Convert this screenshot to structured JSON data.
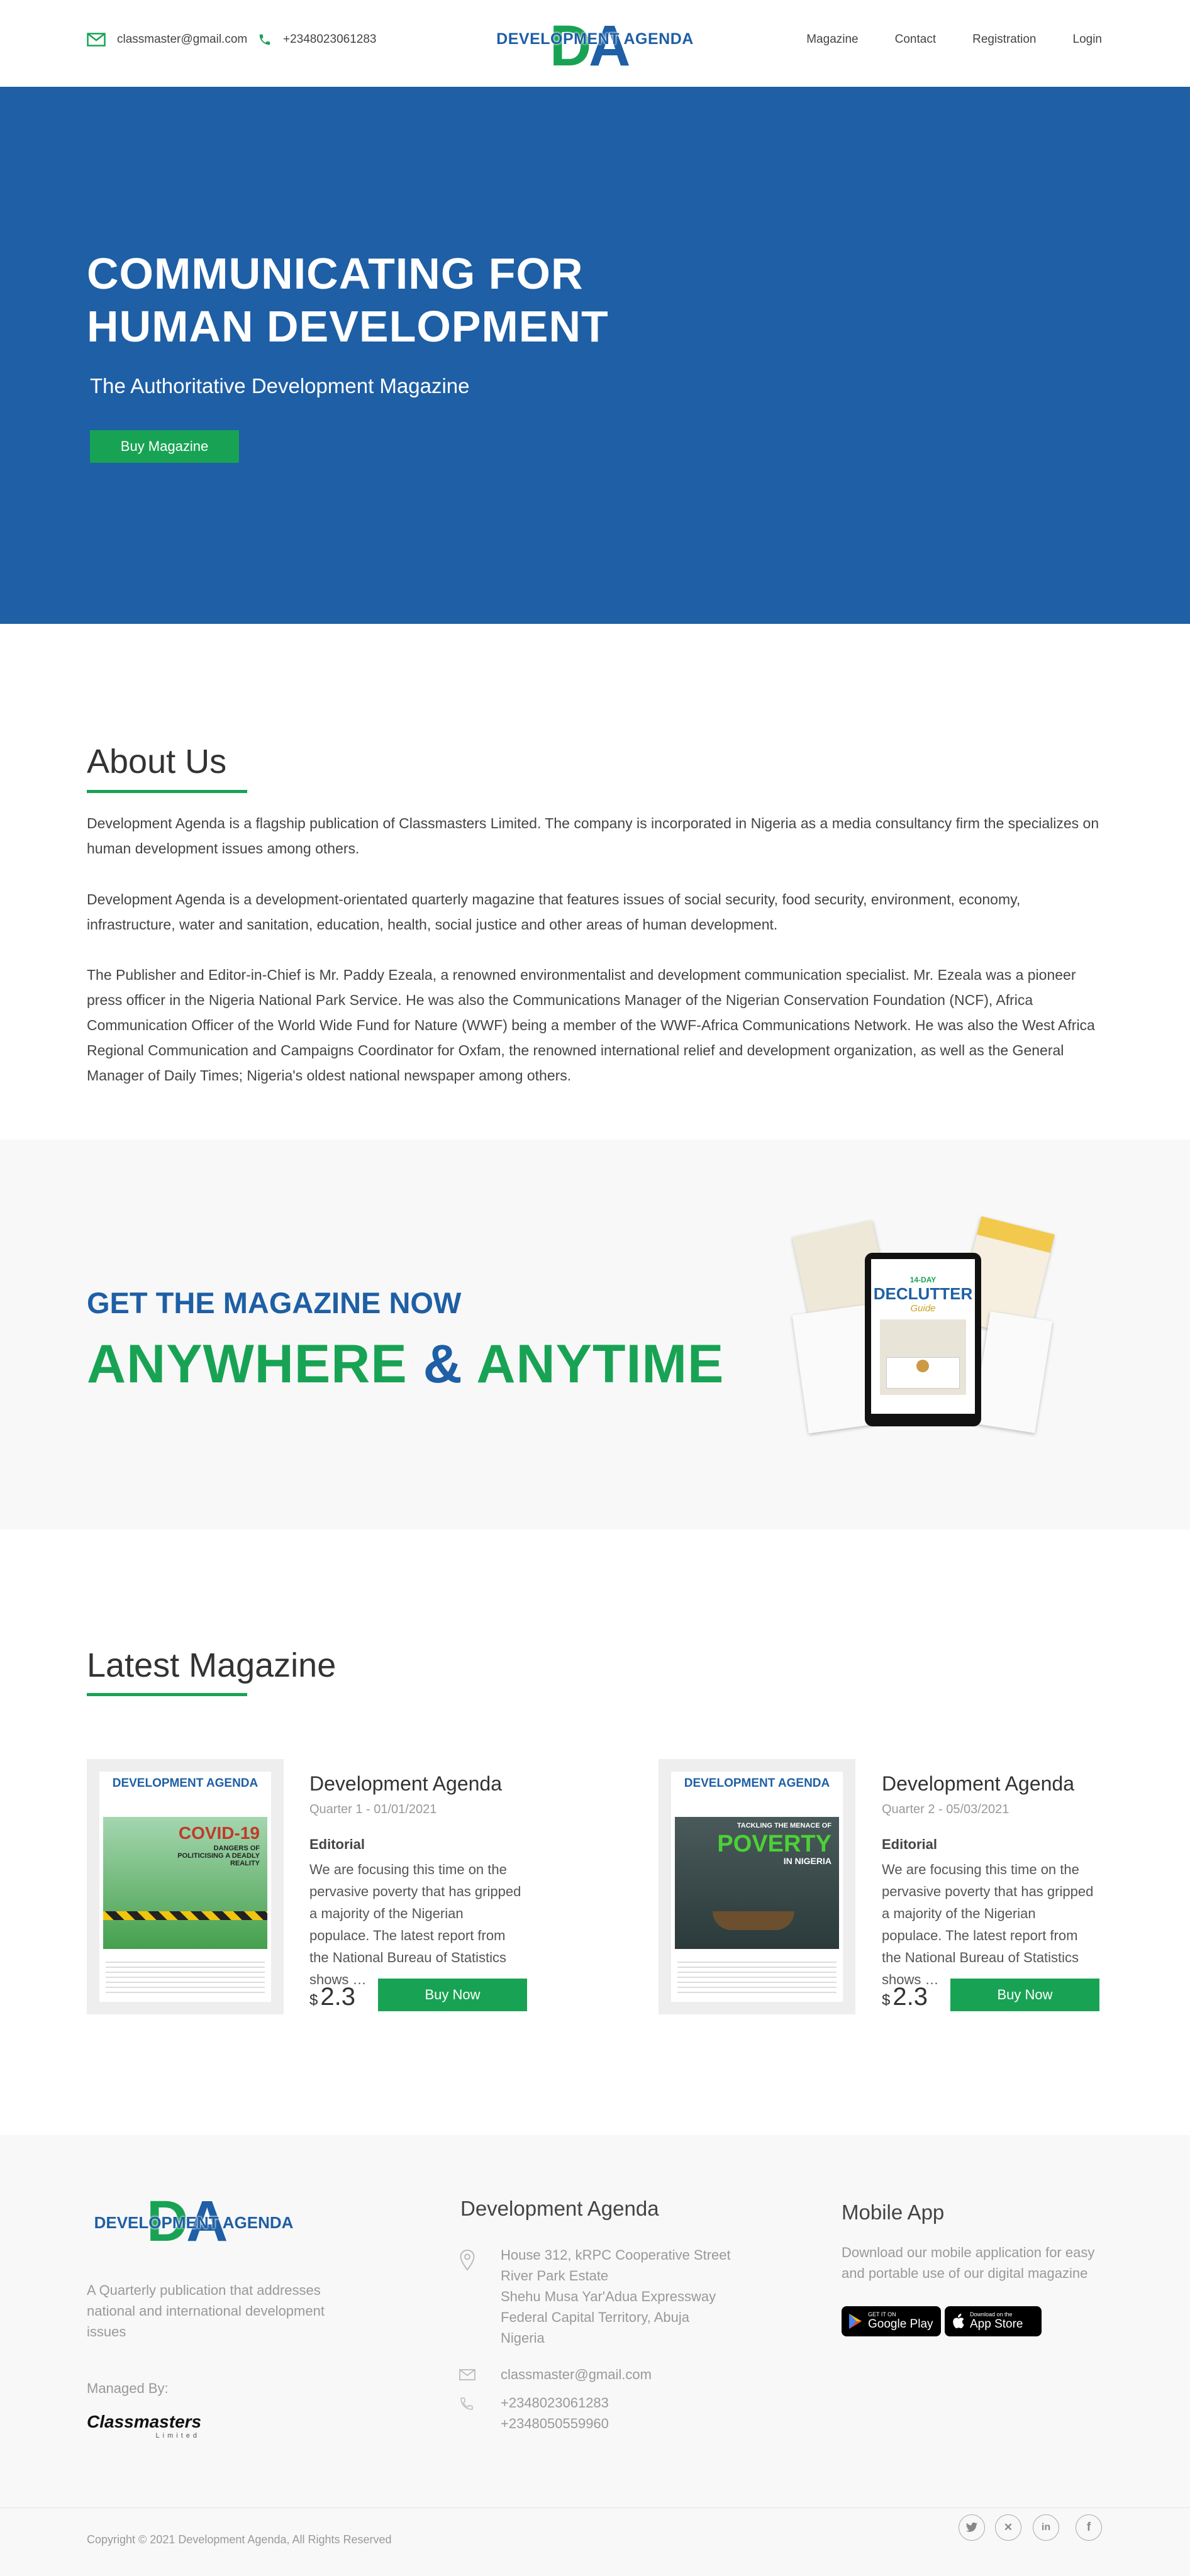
{
  "header": {
    "email": "classmaster@gmail.com",
    "phone": "+2348023061283",
    "logo_text": "DEVELOPMENT AGENDA",
    "logo_mark": "DA",
    "nav": [
      "Magazine",
      "Contact",
      "Registration",
      "Login"
    ]
  },
  "hero": {
    "title": "COMMUNICATING FOR HUMAN DEVELOPMENT",
    "subtitle": "The Authoritative Development Magazine",
    "button": "Buy Magazine"
  },
  "about": {
    "title": "About Us",
    "paragraphs": [
      "Development Agenda is a flagship publication of Classmasters Limited. The company is incorporated in Nigeria as a media consultancy firm the specializes on human development issues among others.",
      "Development Agenda is a development-orientated quarterly magazine that features issues of social security, food security, environment, economy, infrastructure, water and sanitation, education, health, social justice and other areas of human development.",
      "The Publisher and Editor-in-Chief is Mr. Paddy Ezeala, a renowned environmentalist and development communication specialist. Mr. Ezeala was a pioneer press officer in the Nigeria National Park Service. He was also the Communications Manager of the Nigerian Conservation Foundation (NCF), Africa Communication Officer of the World Wide Fund for Nature (WWF) being a member of the WWF-Africa Communications Network. He was also the West Africa Regional Communication and Campaigns Coordinator for Oxfam, the renowned international relief and development organization, as well as the General Manager of Daily Times; Nigeria's oldest national newspaper among others."
    ]
  },
  "promo": {
    "small": "GET THE MAGAZINE NOW",
    "big_1": "ANYWHERE",
    "big_amp": "&",
    "big_2": "ANYTIME",
    "tablet_title_top": "14-DAY",
    "tablet_title": "DECLUTTER",
    "tablet_title_sub": "Guide"
  },
  "latest": {
    "title": "Latest Magazine",
    "items": [
      {
        "name": "Development Agenda",
        "date": "Quarter 1 - 01/01/2021",
        "section": "Editorial",
        "desc": "We are focusing this time on the pervasive poverty that has gripped a majority of the Nigerian populace. The latest report from the National Bureau of Statistics shows …",
        "currency": "$",
        "price": "2.3",
        "button": "Buy Now",
        "cover_headline": "COVID-19",
        "cover_sub": "DANGERS OF POLITICISING A DEADLY REALITY"
      },
      {
        "name": "Development Agenda",
        "date": "Quarter 2 - 05/03/2021",
        "section": "Editorial",
        "desc": "We are focusing this time on the pervasive poverty that has gripped a majority of the Nigerian populace. The latest report from the National Bureau of Statistics shows …",
        "currency": "$",
        "price": "2.3",
        "button": "Buy Now",
        "cover_headline": "POVERTY",
        "cover_sub": "TACKLING THE MENACE OF",
        "cover_sub2": "IN NIGERIA"
      }
    ]
  },
  "footer": {
    "tagline": "A Quarterly publication that addresses national and international development issues",
    "managed_by": "Managed By:",
    "managed_logo": "Classmasters",
    "managed_logo_sub": "Limited",
    "col2_title": "Development Agenda",
    "address": [
      "House 312, kRPC Cooperative Street",
      "River Park Estate",
      "Shehu Musa Yar'Adua Expressway",
      "Federal Capital Territory, Abuja",
      "Nigeria"
    ],
    "email": "classmaster@gmail.com",
    "phones": [
      "+2348023061283",
      "+2348050559960"
    ],
    "col3_title": "Mobile App",
    "app_text": "Download our mobile application for easy and portable use of our digital magazine",
    "google_small": "GET IT ON",
    "google_big": "Google Play",
    "apple_small": "Download on the",
    "apple_big": "App Store",
    "copyright": "Copyright © 2021 Development Agenda, All Rights Reserved"
  },
  "colors": {
    "blue": "#1e5fa5",
    "green": "#18a354",
    "grey_bg": "#f8f8f8"
  },
  "icons": [
    "mail-icon",
    "phone-icon",
    "location-icon",
    "twitter-icon",
    "xing-icon",
    "linkedin-icon",
    "facebook-icon",
    "google-play-icon",
    "apple-icon"
  ]
}
